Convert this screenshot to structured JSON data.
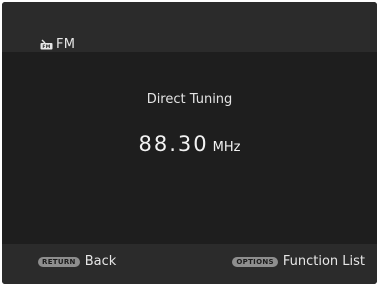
{
  "header": {
    "source_icon": "radio-icon",
    "title": "FM"
  },
  "main": {
    "label": "Direct Tuning",
    "frequency": "88.30",
    "unit": "MHz"
  },
  "footer": {
    "back": {
      "key": "RETURN",
      "label": "Back"
    },
    "options": {
      "key": "OPTIONS",
      "label": "Function List"
    }
  }
}
